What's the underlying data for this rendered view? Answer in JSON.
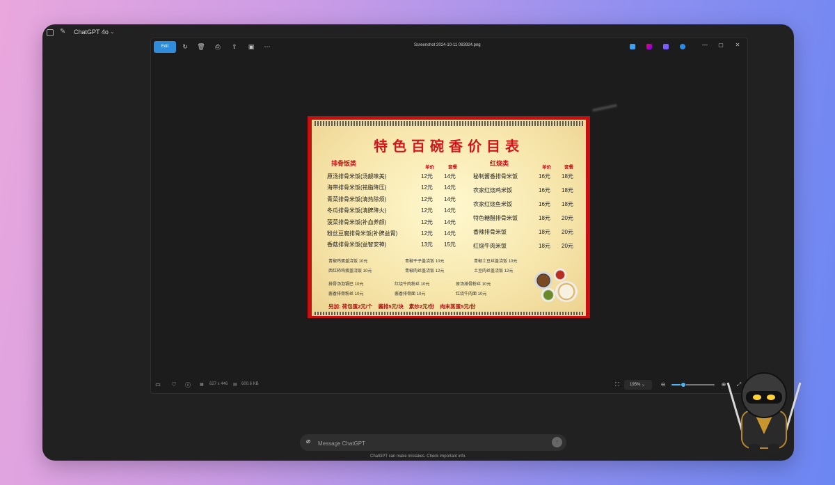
{
  "chatgpt": {
    "model_name": "ChatGPT 4o",
    "composer_placeholder": "Message ChatGPT",
    "disclaimer": "ChatGPT can make mistakes. Check important info."
  },
  "photos": {
    "edit_label": "Edit",
    "file_name": "Screenshot 2024-10-11 083924.png",
    "dimensions": "627 x 446",
    "file_size": "600.6 KB",
    "zoom": "195%",
    "zoom_slider_fraction": 0.28,
    "accent": "#2f8ddb"
  },
  "menu": {
    "title": "特色百碗香价目表",
    "left_section": "排骨饭类",
    "right_section": "红烧类",
    "col_unit": "单价",
    "col_set": "套餐",
    "left_items": [
      {
        "name": "原汤排骨米饭(汤靓味美)",
        "p1": "12元",
        "p2": "14元"
      },
      {
        "name": "海带排骨米饭(祛脂降压)",
        "p1": "12元",
        "p2": "14元"
      },
      {
        "name": "青菜排骨米饭(清热除烦)",
        "p1": "12元",
        "p2": "14元"
      },
      {
        "name": "冬瓜排骨米饭(清脾降火)",
        "p1": "12元",
        "p2": "14元"
      },
      {
        "name": "菠菜排骨米饭(补血养颜)",
        "p1": "12元",
        "p2": "14元"
      },
      {
        "name": "粉丝豆腐排骨米饭(补脾益胃)",
        "p1": "12元",
        "p2": "14元"
      },
      {
        "name": "香菇排骨米饭(益智安神)",
        "p1": "13元",
        "p2": "15元"
      }
    ],
    "right_items": [
      {
        "name": "秘制酱香排骨米饭",
        "p1": "16元",
        "p2": "18元"
      },
      {
        "name": "农家红烧鸡米饭",
        "p1": "16元",
        "p2": "18元"
      },
      {
        "name": "农家红烧鱼米饭",
        "p1": "16元",
        "p2": "18元"
      },
      {
        "name": "特色糖醋排骨米饭",
        "p1": "18元",
        "p2": "20元"
      },
      {
        "name": "香辣排骨米饭",
        "p1": "18元",
        "p2": "20元"
      },
      {
        "name": "红烧牛肉米饭",
        "p1": "18元",
        "p2": "20元"
      }
    ],
    "rice_bowls": [
      [
        "青椒鸡蛋盖浇饭   10元",
        "青椒干子盖浇饭   10元",
        "青椒土豆丝盖浇饭   10元"
      ],
      [
        "西红柿鸡蛋盖浇饭   10元",
        "青椒肉丝盖浇饭   12元",
        "土豆肉丝盖浇饭   12元"
      ]
    ],
    "noodles": [
      [
        "排骨汤泡锅巴  10元",
        "红烧牛肉粉丝  10元",
        "原汤排骨粉丝  10元"
      ],
      [
        "酱香排骨粉丝  10元",
        "酱香排骨面   10元",
        "红烧牛肉面   10元"
      ]
    ],
    "extras": [
      "另加: 荷包蛋2元/个",
      "酱排5元/块",
      "素炒2元/份",
      "肉末蒸蛋5元/份"
    ]
  }
}
